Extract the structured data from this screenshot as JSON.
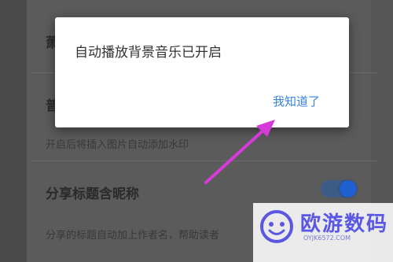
{
  "dialog": {
    "message": "自动播放背景音乐已开启",
    "confirm_label": "我知道了"
  },
  "settings": {
    "item1_title_partial": "萧",
    "item2_title_partial": "普",
    "item2_desc": "开启后将插入图片自动添加水印",
    "item3_title": "分享标题含昵称",
    "item3_desc": "分享的标题自动加上作者名，帮助读者",
    "item3_toggle_on": true
  },
  "watermark": {
    "name": "欧游数码",
    "url": "OYJK6572.COM"
  },
  "colors": {
    "accent_link": "#3a83d6",
    "toggle_on": "#1e5fd1",
    "arrow": "#d63ad9",
    "watermark_text": "#5a57e5"
  }
}
